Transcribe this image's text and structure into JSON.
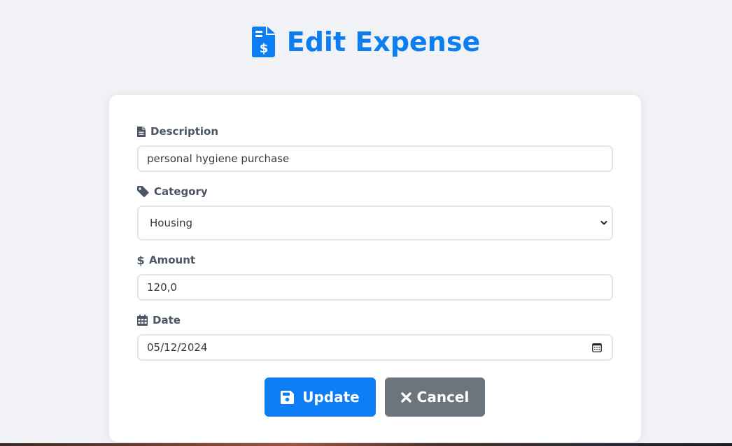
{
  "page": {
    "title": "Edit Expense",
    "title_icon": "file-invoice-dollar-icon",
    "accent_color": "#0d7df2"
  },
  "form": {
    "description": {
      "label": "Description",
      "icon": "file-icon",
      "value": "personal hygiene purchase"
    },
    "category": {
      "label": "Category",
      "icon": "tag-icon",
      "value": "Housing"
    },
    "amount": {
      "label": "Amount",
      "icon": "dollar-icon",
      "value": "120,0"
    },
    "date": {
      "label": "Date",
      "icon": "calendar-icon",
      "value": "05/12/2024"
    }
  },
  "actions": {
    "update_label": "Update",
    "update_icon": "save-icon",
    "update_color": "#0d7ef5",
    "cancel_label": "Cancel",
    "cancel_icon": "x-icon",
    "cancel_color": "#6c757d"
  }
}
